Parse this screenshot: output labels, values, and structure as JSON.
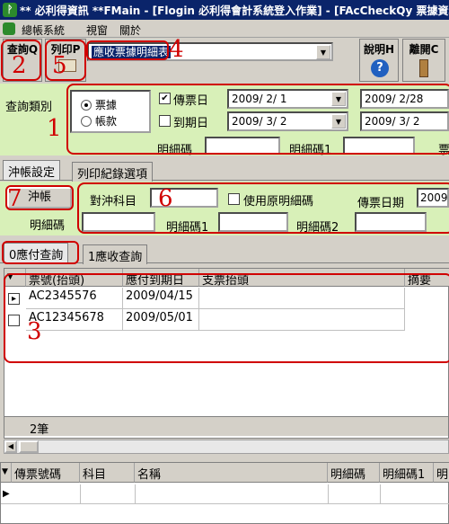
{
  "window": {
    "title": "** 必利得資訊 **FMain - [Flogin 必利得會計系統登入作業] - [FAcCheckQy 票據資料"
  },
  "menu": [
    "總帳系統",
    "視窗",
    "關於"
  ],
  "toolbar": {
    "query_label": "查詢Q",
    "print_label": "列印P",
    "report_value": "應收票據明細表",
    "help_label": "說明H",
    "exit_label": "離開C"
  },
  "annotations": {
    "n1": "1",
    "n2": "2",
    "n3": "3",
    "n4": "4",
    "n5": "5",
    "n6": "6",
    "n7": "7"
  },
  "query": {
    "type_label": "查詢類別",
    "radio_ticket": "票據",
    "radio_account": "帳款",
    "voucher_date_label": "傳票日",
    "voucher_from": "2009/ 2/ 1",
    "voucher_to": "2009/ 2/28",
    "due_date_label": "到期日",
    "due_from": "2009/ 3/ 2",
    "due_to": "2009/ 3/ 2",
    "detail_code_label": "明細碼",
    "detail_code1_label": "明細碼1",
    "ticket_cut_label": "票"
  },
  "tabs_top": [
    "沖帳設定",
    "列印紀錄選項"
  ],
  "writeoff": {
    "button": "沖帳",
    "account_label": "對沖科目",
    "use_original_label": "使用原明細碼",
    "voucher_date_label": "傳票日期",
    "voucher_date_value": "2009/",
    "detail_code_label": "明細碼",
    "detail_code1_label": "明細碼1",
    "detail_code2_label": "明細碼2"
  },
  "tabs_query": [
    "0應付查詢",
    "1應收查詢"
  ],
  "grid": {
    "columns": [
      "票號(抬頭)",
      "應付到期日",
      "支票抬頭",
      "摘要"
    ],
    "rows": [
      {
        "no": "AC2345576",
        "date": "2009/04/15"
      },
      {
        "no": "AC12345678",
        "date": "2009/05/01"
      }
    ],
    "footer": "2筆"
  },
  "bottom_grid": {
    "columns": [
      "傳票號碼",
      "科目",
      "名稱",
      "明細碼",
      "明細碼1",
      "明"
    ]
  }
}
